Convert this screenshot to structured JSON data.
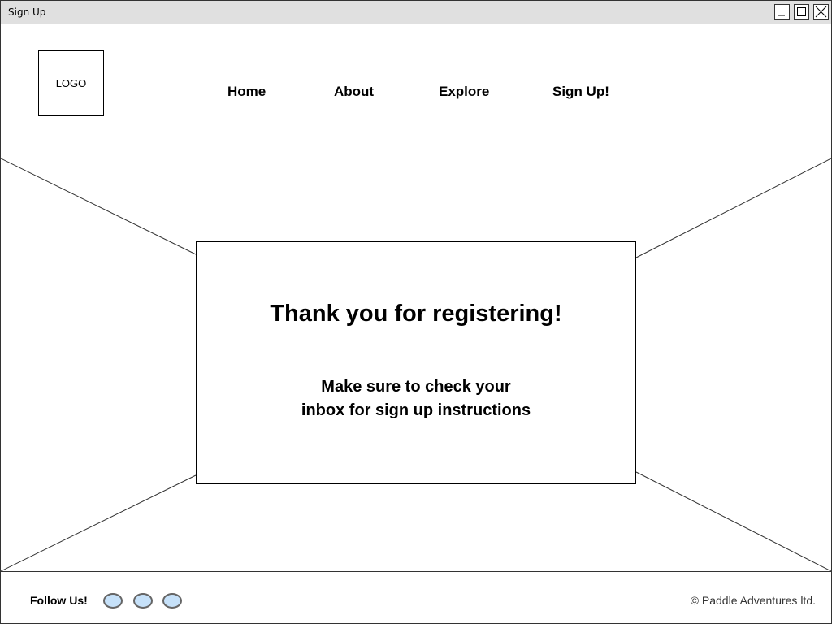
{
  "window": {
    "title": "Sign Up"
  },
  "header": {
    "logo_text": "LOGO",
    "nav": {
      "home": "Home",
      "about": "About",
      "explore": "Explore",
      "signup": "Sign Up!"
    }
  },
  "hero": {
    "title": "Thank you for registering!",
    "message_line1": "Make sure to check your",
    "message_line2": "inbox for sign up instructions"
  },
  "footer": {
    "follow_label": "Follow Us!",
    "social_icons": [
      "social-circle-icon",
      "social-circle-icon",
      "social-circle-icon"
    ],
    "copyright": "© Paddle Adventures ltd."
  },
  "colors": {
    "titlebar_bg": "#e0e0e0",
    "social_fill": "#c6e1f9",
    "social_border": "#666666"
  }
}
